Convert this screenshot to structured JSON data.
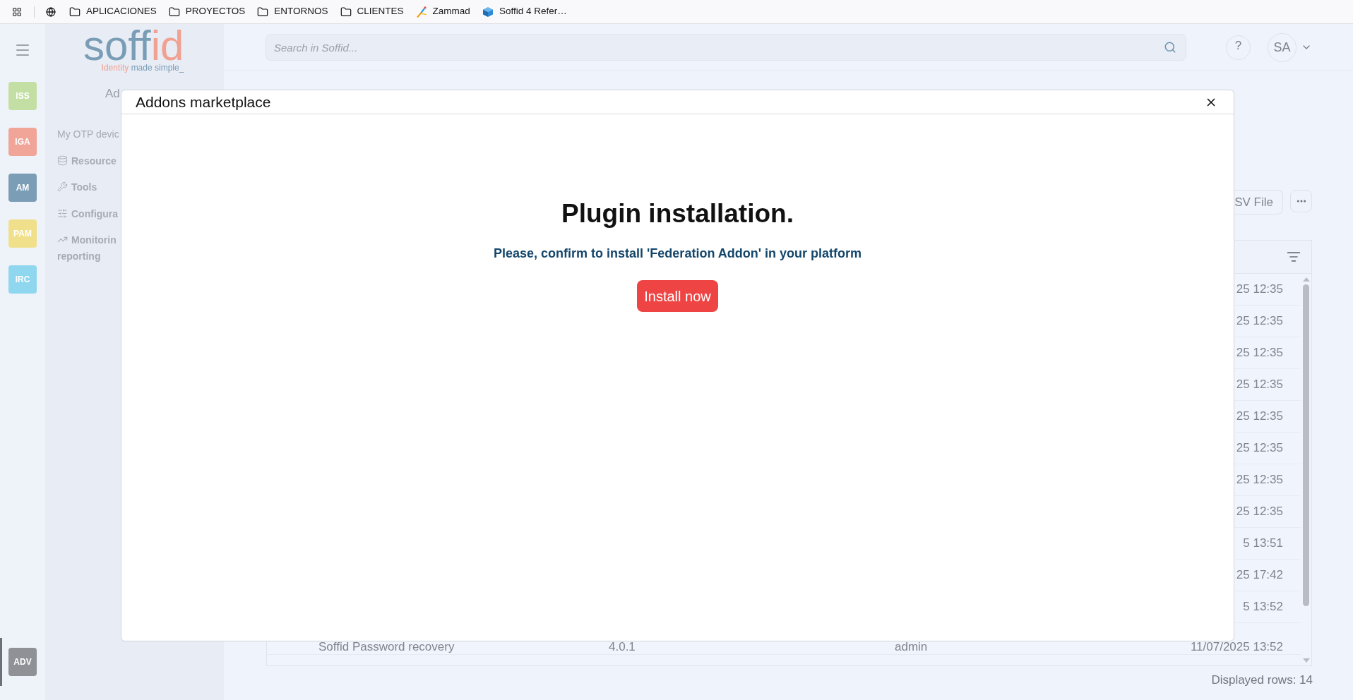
{
  "bookmarks_bar": {
    "items": [
      {
        "kind": "folder",
        "label": "APLICACIONES"
      },
      {
        "kind": "folder",
        "label": "PROYECTOS"
      },
      {
        "kind": "folder",
        "label": "ENTORNOS"
      },
      {
        "kind": "folder",
        "label": "CLIENTES"
      },
      {
        "kind": "figure",
        "label": "Zammad"
      },
      {
        "kind": "cube",
        "label": "Soffid 4 Refer…"
      }
    ]
  },
  "app_rail": {
    "modules": [
      {
        "label": "ISS",
        "color": "#c4dfa3"
      },
      {
        "label": "IGA",
        "color": "#f0a598"
      },
      {
        "label": "AM",
        "color": "#7b9db6"
      },
      {
        "label": "PAM",
        "color": "#f1e08b"
      },
      {
        "label": "IRC",
        "color": "#8fd6ef"
      }
    ],
    "footer_module": {
      "label": "ADV",
      "color": "#8f9197",
      "selected": true
    }
  },
  "sidebar": {
    "logo": {
      "parts": [
        {
          "text": "soff",
          "color": "#7a9db6"
        },
        {
          "text": "id",
          "color": "#f0a191"
        }
      ]
    },
    "tagline": {
      "parts": [
        {
          "text": "Identity",
          "color": "#f0a191"
        },
        {
          "text": "made simple_",
          "color": "#7a9db6"
        }
      ]
    },
    "title": "Ad",
    "items": [
      {
        "kind": "plain",
        "lines": [
          "My OTP devic"
        ]
      },
      {
        "kind": "database",
        "lines": [
          "Resource"
        ]
      },
      {
        "kind": "wrench",
        "lines": [
          "Tools"
        ]
      },
      {
        "kind": "sliders",
        "lines": [
          "Configura"
        ]
      },
      {
        "kind": "chart",
        "lines": [
          "Monitorin",
          "reporting"
        ]
      }
    ]
  },
  "header": {
    "search": {
      "placeholder": "Search in Soffid..."
    },
    "help": "?",
    "user_initials": "SA"
  },
  "toolbar": {
    "file_button": "SV File"
  },
  "table": {
    "rows": [
      {
        "column_5": "25 12:35"
      },
      {
        "column_5": "25 12:35"
      },
      {
        "column_5": "25 12:35"
      },
      {
        "column_5": "25 12:35"
      },
      {
        "column_5": "25 12:35"
      },
      {
        "column_5": "25 12:35"
      },
      {
        "column_5": "25 12:35"
      },
      {
        "column_5": "25 12:35"
      },
      {
        "column_5": "5 13:51"
      },
      {
        "column_5": "25 17:42"
      },
      {
        "column_5": "5 13:52"
      },
      {
        "column_2": "Soffid Password recovery",
        "column_3": "4.0.1",
        "column_4": "admin",
        "column_5": "11/07/2025 13:52"
      }
    ],
    "footer": "Displayed rows: 14"
  },
  "modal": {
    "title": "Addons marketplace",
    "heading": "Plugin installation.",
    "message": "Please, confirm to install 'Federation Addon' in your platform",
    "button": "Install now"
  }
}
